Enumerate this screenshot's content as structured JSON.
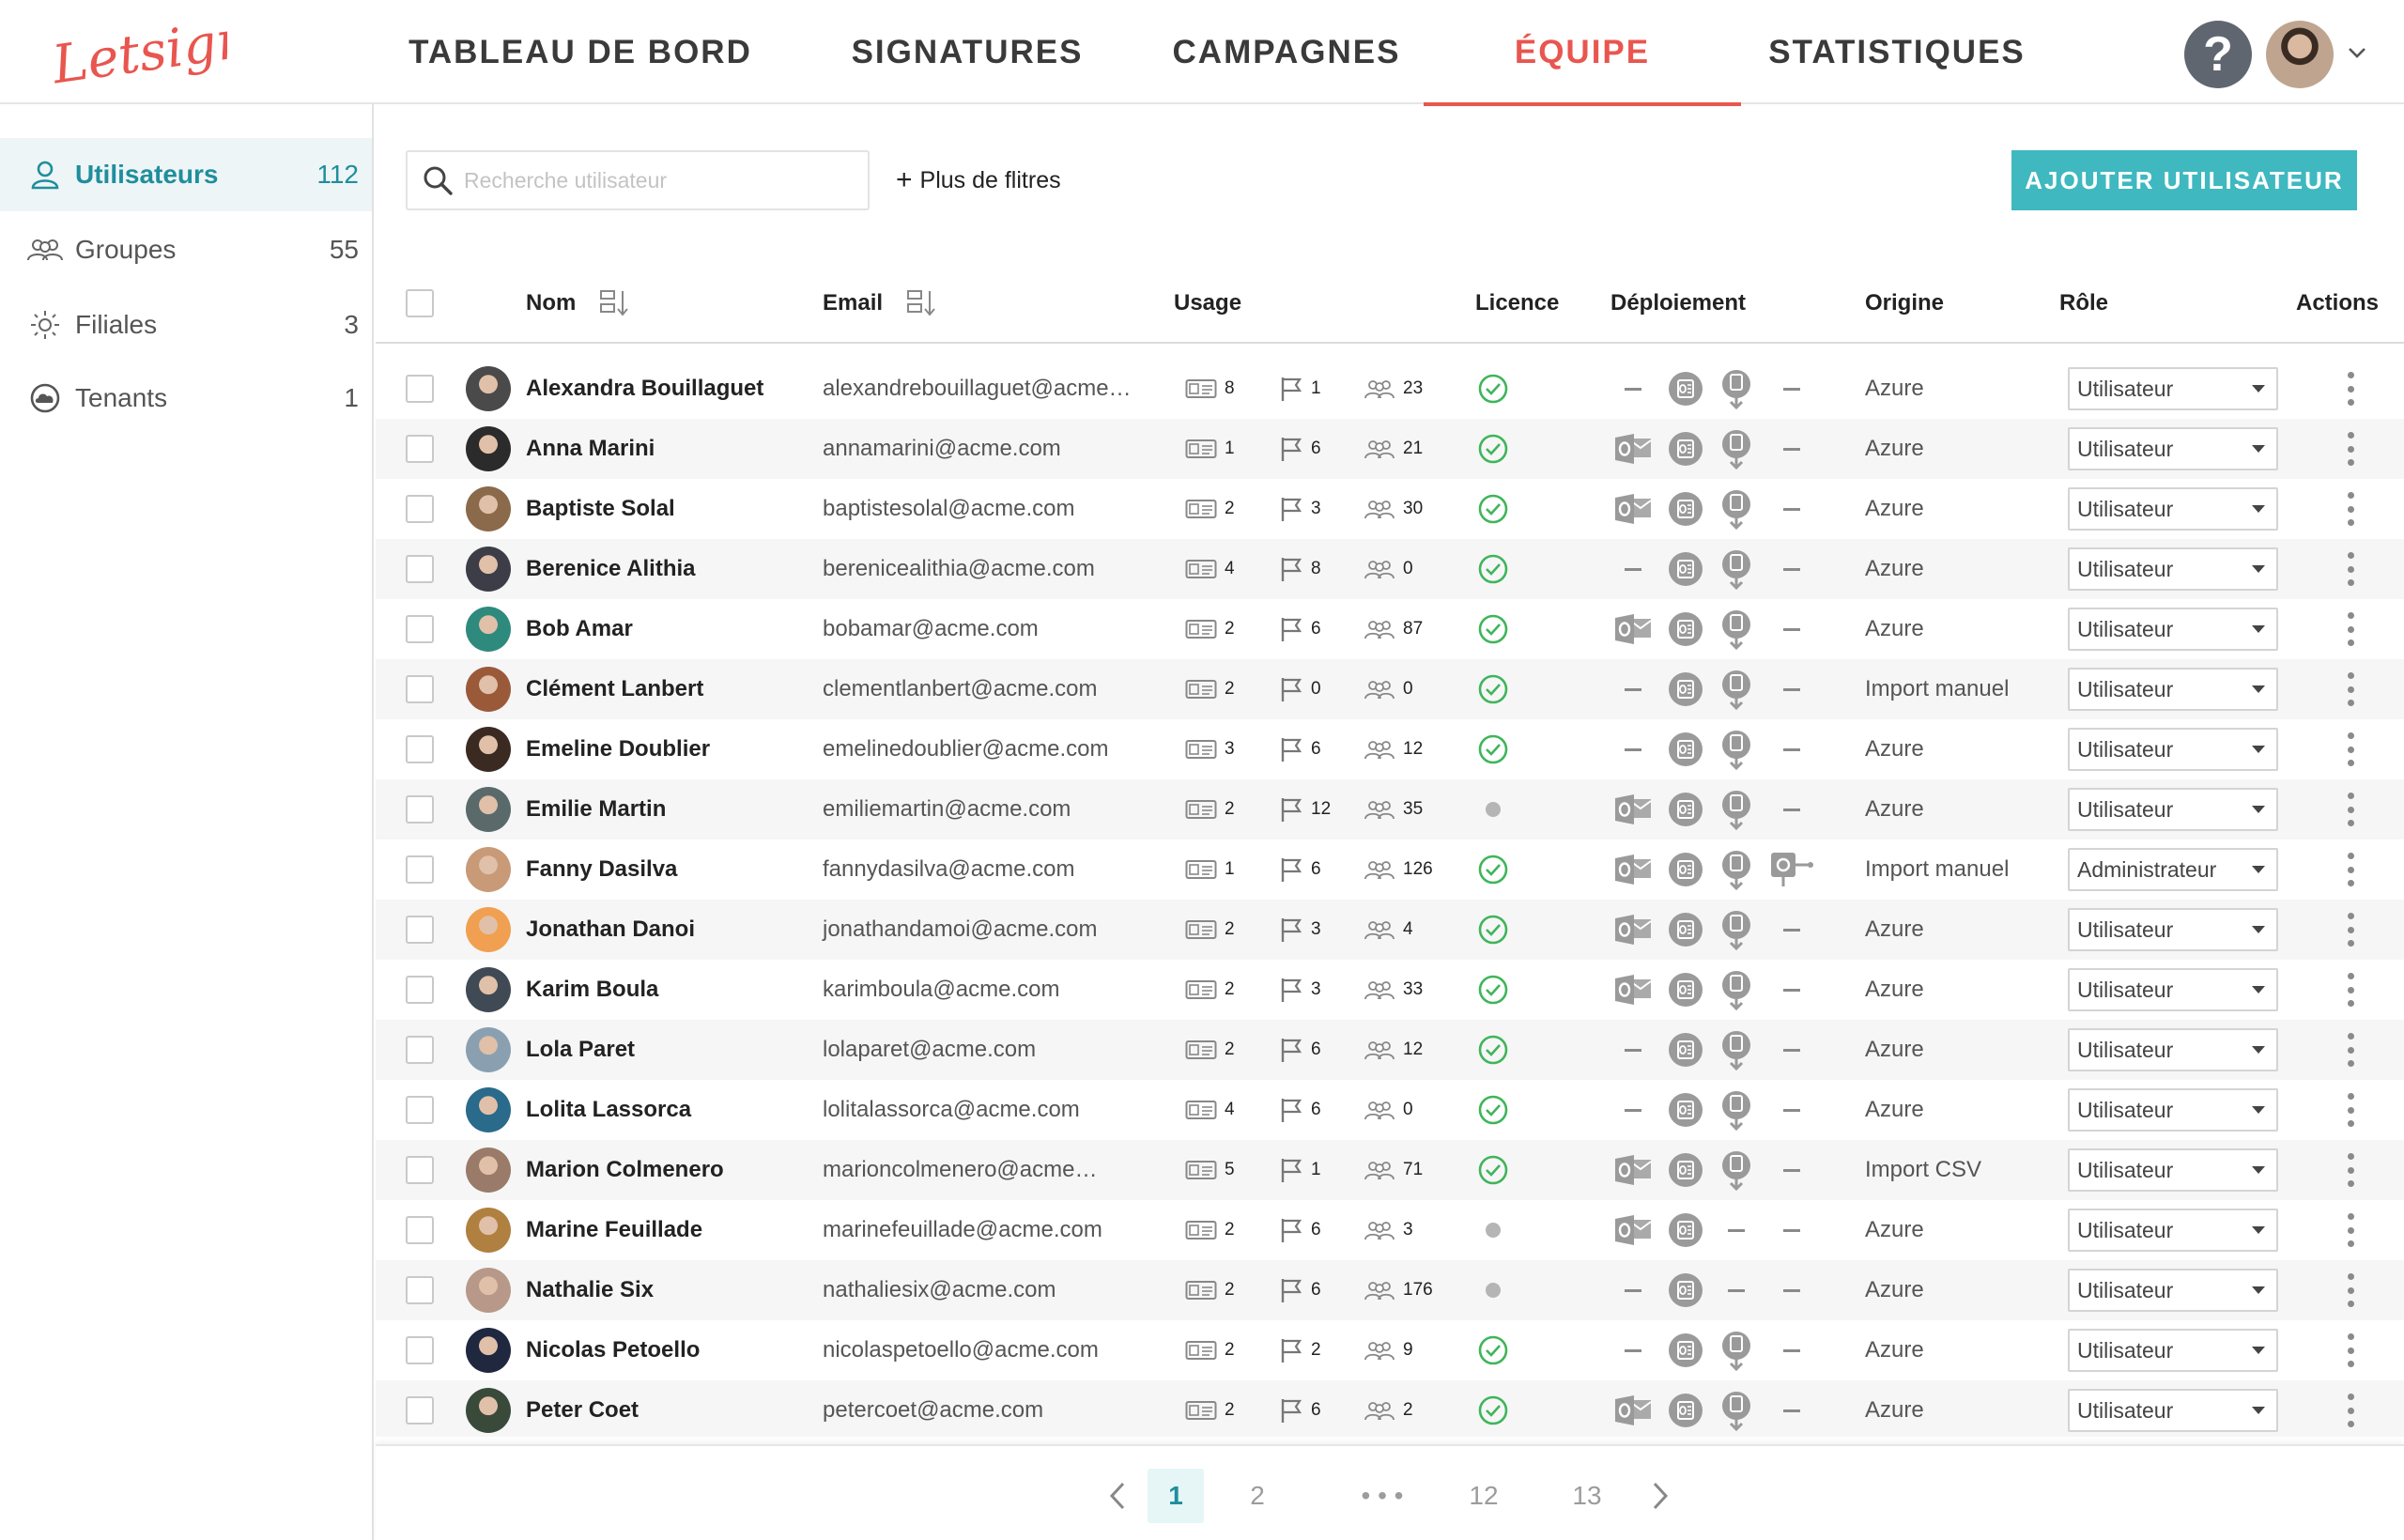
{
  "header": {
    "logo_text": "Letsignit",
    "nav": [
      {
        "label": "TABLEAU DE BORD",
        "active": false
      },
      {
        "label": "SIGNATURES",
        "active": false
      },
      {
        "label": "CAMPAGNES",
        "active": false
      },
      {
        "label": "ÉQUIPE",
        "active": true
      },
      {
        "label": "STATISTIQUES",
        "active": false
      }
    ],
    "help_label": "?",
    "accent_color": "#e8564f"
  },
  "sidebar": {
    "items": [
      {
        "label": "Utilisateurs",
        "count": "112",
        "icon": "user-icon",
        "active": true
      },
      {
        "label": "Groupes",
        "count": "55",
        "icon": "group-icon",
        "active": false
      },
      {
        "label": "Filiales",
        "count": "3",
        "icon": "sun-icon",
        "active": false
      },
      {
        "label": "Tenants",
        "count": "1",
        "icon": "cloud-icon",
        "active": false
      }
    ]
  },
  "toolbar": {
    "search_placeholder": "Recherche utilisateur",
    "filters_label": "Plus de flitres",
    "add_user_label": "AJOUTER UTILISATEUR",
    "button_color": "#3fb8c0"
  },
  "table": {
    "headers": {
      "name": "Nom",
      "email": "Email",
      "usage": "Usage",
      "licence": "Licence",
      "deployment": "Déploiement",
      "origin": "Origine",
      "role": "Rôle",
      "actions": "Actions"
    },
    "rows": [
      {
        "name": "Alexandra Bouillaguet",
        "email": "alexandrebouillaguet@acme…",
        "sig": "8",
        "camp": "1",
        "groups": "23",
        "licence": true,
        "outlook": false,
        "addin": true,
        "mobile": true,
        "extra": false,
        "origin": "Azure",
        "role": "Utilisateur",
        "avatar": "#4a4a4a"
      },
      {
        "name": "Anna Marini",
        "email": "annamarini@acme.com",
        "sig": "1",
        "camp": "6",
        "groups": "21",
        "licence": true,
        "outlook": true,
        "addin": true,
        "mobile": true,
        "extra": false,
        "origin": "Azure",
        "role": "Utilisateur",
        "avatar": "#2b2b2b"
      },
      {
        "name": "Baptiste Solal",
        "email": "baptistesolal@acme.com",
        "sig": "2",
        "camp": "3",
        "groups": "30",
        "licence": true,
        "outlook": true,
        "addin": true,
        "mobile": true,
        "extra": false,
        "origin": "Azure",
        "role": "Utilisateur",
        "avatar": "#8a6a4a"
      },
      {
        "name": "Berenice Alithia",
        "email": "berenicealithia@acme.com",
        "sig": "4",
        "camp": "8",
        "groups": "0",
        "licence": true,
        "outlook": false,
        "addin": true,
        "mobile": true,
        "extra": false,
        "origin": "Azure",
        "role": "Utilisateur",
        "avatar": "#3d3d48"
      },
      {
        "name": "Bob Amar",
        "email": "bobamar@acme.com",
        "sig": "2",
        "camp": "6",
        "groups": "87",
        "licence": true,
        "outlook": true,
        "addin": true,
        "mobile": true,
        "extra": false,
        "origin": "Azure",
        "role": "Utilisateur",
        "avatar": "#2f8a7e"
      },
      {
        "name": "Clément Lanbert",
        "email": "clementlanbert@acme.com",
        "sig": "2",
        "camp": "0",
        "groups": "0",
        "licence": true,
        "outlook": false,
        "addin": true,
        "mobile": true,
        "extra": false,
        "origin": "Import manuel",
        "role": "Utilisateur",
        "avatar": "#9a5a3a"
      },
      {
        "name": "Emeline Doublier",
        "email": "emelinedoublier@acme.com",
        "sig": "3",
        "camp": "6",
        "groups": "12",
        "licence": true,
        "outlook": false,
        "addin": true,
        "mobile": true,
        "extra": false,
        "origin": "Azure",
        "role": "Utilisateur",
        "avatar": "#3a2a22"
      },
      {
        "name": "Emilie Martin",
        "email": "emiliemartin@acme.com",
        "sig": "2",
        "camp": "12",
        "groups": "35",
        "licence": false,
        "outlook": true,
        "addin": true,
        "mobile": true,
        "extra": false,
        "origin": "Azure",
        "role": "Utilisateur",
        "avatar": "#5a6a6a"
      },
      {
        "name": "Fanny Dasilva",
        "email": "fannydasilva@acme.com",
        "sig": "1",
        "camp": "6",
        "groups": "126",
        "licence": true,
        "outlook": true,
        "addin": true,
        "mobile": true,
        "extra": true,
        "origin": "Import manuel",
        "role": "Administrateur",
        "avatar": "#c89a78"
      },
      {
        "name": "Jonathan Danoi",
        "email": "jonathandamoi@acme.com",
        "sig": "2",
        "camp": "3",
        "groups": "4",
        "licence": true,
        "outlook": true,
        "addin": true,
        "mobile": true,
        "extra": false,
        "origin": "Azure",
        "role": "Utilisateur",
        "avatar": "#f0a050"
      },
      {
        "name": "Karim Boula",
        "email": "karimboula@acme.com",
        "sig": "2",
        "camp": "3",
        "groups": "33",
        "licence": true,
        "outlook": true,
        "addin": true,
        "mobile": true,
        "extra": false,
        "origin": "Azure",
        "role": "Utilisateur",
        "avatar": "#404a55"
      },
      {
        "name": "Lola Paret",
        "email": "lolaparet@acme.com",
        "sig": "2",
        "camp": "6",
        "groups": "12",
        "licence": true,
        "outlook": false,
        "addin": true,
        "mobile": true,
        "extra": false,
        "origin": "Azure",
        "role": "Utilisateur",
        "avatar": "#8aa0b0"
      },
      {
        "name": "Lolita Lassorca",
        "email": "lolitalassorca@acme.com",
        "sig": "4",
        "camp": "6",
        "groups": "0",
        "licence": true,
        "outlook": false,
        "addin": true,
        "mobile": true,
        "extra": false,
        "origin": "Azure",
        "role": "Utilisateur",
        "avatar": "#2a6a8a"
      },
      {
        "name": "Marion Colmenero",
        "email": "marioncolmenero@acme…",
        "sig": "5",
        "camp": "1",
        "groups": "71",
        "licence": true,
        "outlook": true,
        "addin": true,
        "mobile": true,
        "extra": false,
        "origin": "Import CSV",
        "role": "Utilisateur",
        "avatar": "#9a7a68"
      },
      {
        "name": "Marine Feuillade",
        "email": "marinefeuillade@acme.com",
        "sig": "2",
        "camp": "6",
        "groups": "3",
        "licence": false,
        "outlook": true,
        "addin": true,
        "mobile": false,
        "extra": false,
        "origin": "Azure",
        "role": "Utilisateur",
        "avatar": "#b08040"
      },
      {
        "name": "Nathalie Six",
        "email": "nathaliesix@acme.com",
        "sig": "2",
        "camp": "6",
        "groups": "176",
        "licence": false,
        "outlook": false,
        "addin": true,
        "mobile": false,
        "extra": false,
        "origin": "Azure",
        "role": "Utilisateur",
        "avatar": "#b89888"
      },
      {
        "name": "Nicolas Petoello",
        "email": "nicolaspetoello@acme.com",
        "sig": "2",
        "camp": "2",
        "groups": "9",
        "licence": true,
        "outlook": false,
        "addin": true,
        "mobile": true,
        "extra": false,
        "origin": "Azure",
        "role": "Utilisateur",
        "avatar": "#202840"
      },
      {
        "name": "Peter Coet",
        "email": "petercoet@acme.com",
        "sig": "2",
        "camp": "6",
        "groups": "2",
        "licence": true,
        "outlook": true,
        "addin": true,
        "mobile": true,
        "extra": false,
        "origin": "Azure",
        "role": "Utilisateur",
        "avatar": "#3a4a3a"
      }
    ],
    "licence_color": "#3fb55a"
  },
  "pagination": {
    "pages": [
      "1",
      "2",
      "• • •",
      "12",
      "13"
    ],
    "active_page": "1"
  }
}
